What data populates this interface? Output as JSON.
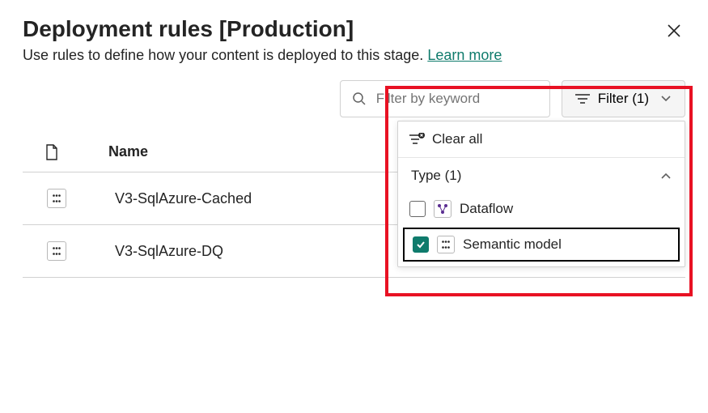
{
  "header": {
    "title": "Deployment rules [Production]",
    "subtitle": "Use rules to define how your content is deployed to this stage.",
    "learn_more": "Learn more"
  },
  "toolbar": {
    "search_placeholder": "Filter by keyword",
    "filter_label": "Filter (1)"
  },
  "filter_panel": {
    "clear_label": "Clear all",
    "section_label": "Type (1)",
    "options": [
      {
        "label": "Dataflow",
        "checked": false,
        "icon": "dataflow-icon"
      },
      {
        "label": "Semantic model",
        "checked": true,
        "icon": "semantic-model-icon"
      }
    ]
  },
  "table": {
    "col_name": "Name",
    "rows": [
      {
        "name": "V3-SqlAzure-Cached",
        "icon": "semantic-model-icon"
      },
      {
        "name": "V3-SqlAzure-DQ",
        "icon": "semantic-model-icon"
      }
    ]
  }
}
